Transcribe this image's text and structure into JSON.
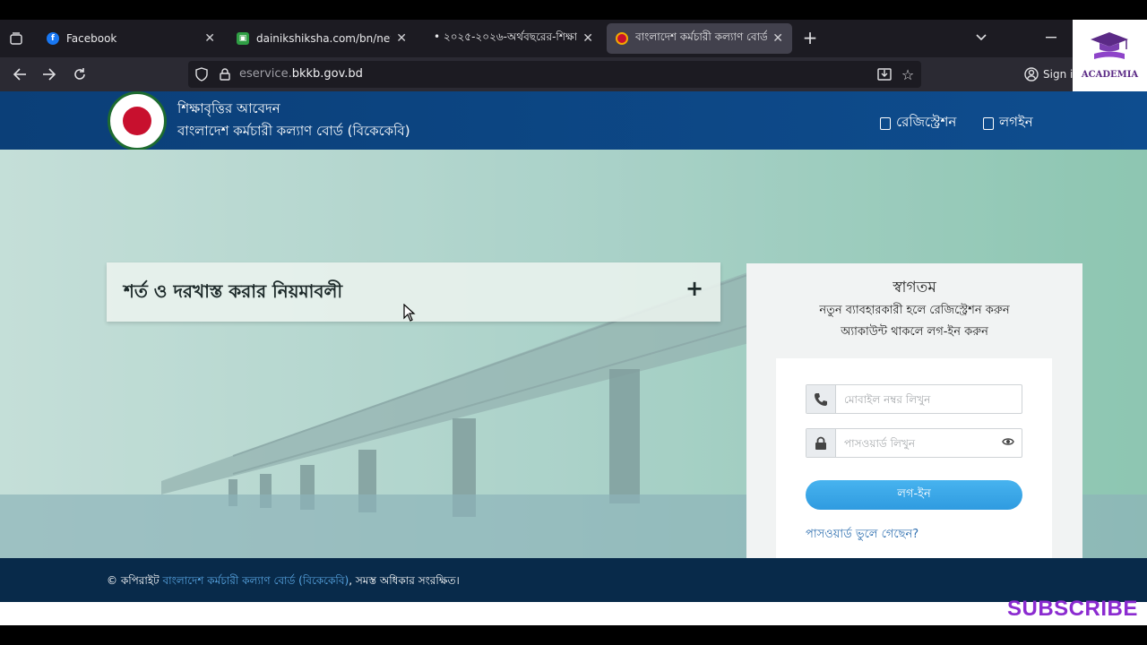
{
  "browser": {
    "tabs": [
      {
        "title": "Facebook",
        "favicon": "facebook-icon",
        "active": false
      },
      {
        "title": "dainikshiksha.com/bn/news/the",
        "favicon": "dainikshiksha-icon",
        "active": false
      },
      {
        "title": "• ২০২৫-২০২৬-অর্থবছরের-শিক্ষা",
        "favicon": "",
        "active": false
      },
      {
        "title": "বাংলাদেশ কর্মচারী কল্যাণ বোর্ড (",
        "favicon": "bkkb-icon",
        "active": true
      }
    ],
    "url_domain": "eservice.",
    "url_host": "bkkb.gov.bd",
    "sign_in": "Sign in"
  },
  "academia": {
    "label": "ACADEMIA"
  },
  "header": {
    "title": "শিক্ষাবৃত্তির আবেদন",
    "subtitle": "বাংলাদেশ কর্মচারী কল্যাণ বোর্ড (বিকেকেবি)",
    "registration_label": "রেজিস্ট্রেশন",
    "login_label": "লগইন"
  },
  "accordion": {
    "title": "শর্ত ও দরখাস্ত করার নিয়মাবলী",
    "toggle": "+"
  },
  "login": {
    "welcome": "স্বাগতম",
    "line2": "নতুন ব্যাবহারকারী হলে রেজিস্ট্রেশন করুন",
    "line3": "অ্যাকাউন্ট থাকলে লগ-ইন করুন",
    "mobile_placeholder": "মোবাইল নম্বর লিখুন",
    "password_placeholder": "পাসওয়ার্ড লিখুন",
    "button": "লগ-ইন",
    "forgot": "পাসওয়ার্ড ভুলে গেছেন?"
  },
  "footer": {
    "prefix": "© কপিরাইট ",
    "link": "বাংলাদেশ কর্মচারী কল্যাণ বোর্ড (বিকেকেবি)",
    "suffix": ", সমস্ত অধিকার সংরক্ষিত।"
  },
  "overlay": {
    "subscribe": "SUBSCRIBE"
  },
  "colors": {
    "header_bg": "#0b3f78",
    "footer_bg": "#082a4a",
    "button": "#2f9be0",
    "subscribe": "#8b2bd0"
  }
}
